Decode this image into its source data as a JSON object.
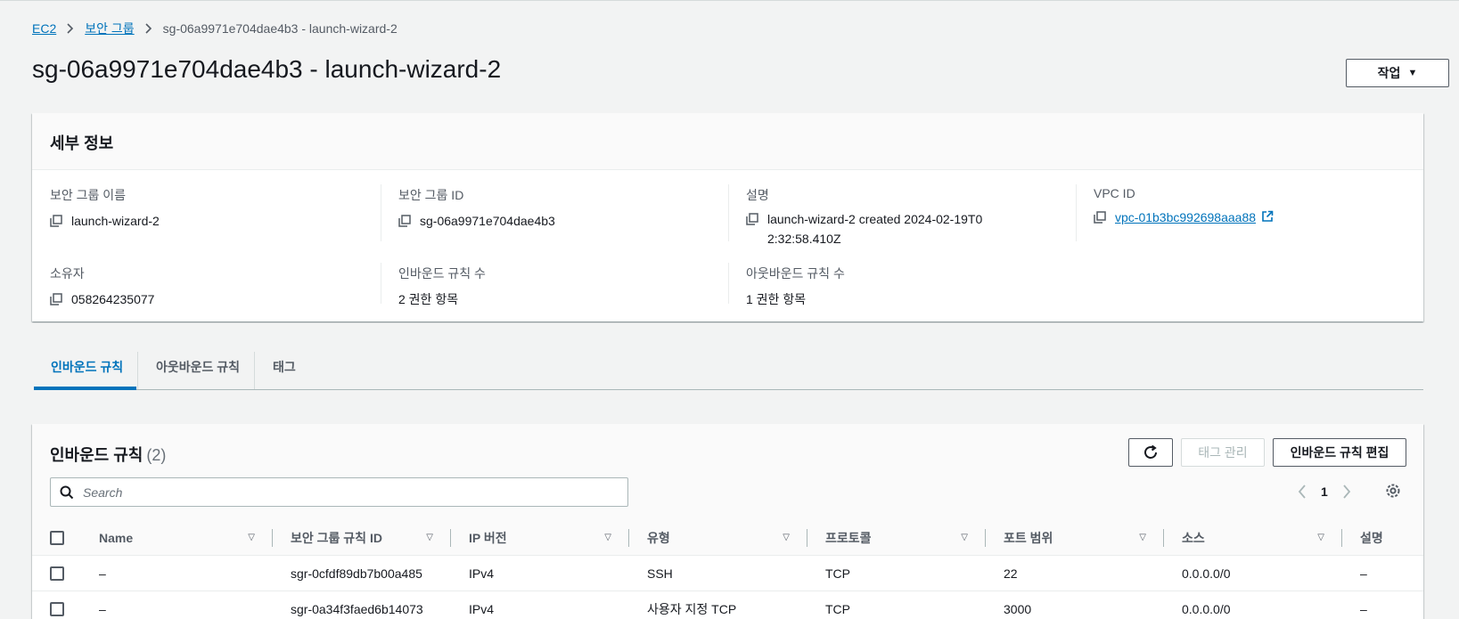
{
  "breadcrumb": {
    "items": [
      "EC2",
      "보안 그룹"
    ],
    "current": "sg-06a9971e704dae4b3 - launch-wizard-2"
  },
  "page": {
    "title": "sg-06a9971e704dae4b3 - launch-wizard-2",
    "actions_label": "작업"
  },
  "details": {
    "heading": "세부 정보",
    "fields": {
      "sg_name": {
        "label": "보안 그룹 이름",
        "value": "launch-wizard-2"
      },
      "sg_id": {
        "label": "보안 그룹 ID",
        "value": "sg-06a9971e704dae4b3"
      },
      "description": {
        "label": "설명",
        "value": "launch-wizard-2 created 2024-02-19T02:32:58.410Z"
      },
      "vpc_id": {
        "label": "VPC ID",
        "value": "vpc-01b3bc992698aaa88"
      },
      "owner": {
        "label": "소유자",
        "value": "058264235077"
      },
      "inbound_count": {
        "label": "인바운드 규칙 수",
        "value": "2 권한 항목"
      },
      "outbound_count": {
        "label": "아웃바운드 규칙 수",
        "value": "1 권한 항목"
      }
    }
  },
  "tabs": [
    "인바운드 규칙",
    "아웃바운드 규칙",
    "태그"
  ],
  "inbound": {
    "title": "인바운드 규칙",
    "count": "(2)",
    "manage_tags_label": "태그 관리",
    "edit_label": "인바운드 규칙 편집",
    "search_placeholder": "Search",
    "page": "1",
    "columns": [
      "Name",
      "보안 그룹 규칙 ID",
      "IP 버전",
      "유형",
      "프로토콜",
      "포트 범위",
      "소스",
      "설명"
    ],
    "rows": [
      [
        "–",
        "sgr-0cfdf89db7b00a485",
        "IPv4",
        "SSH",
        "TCP",
        "22",
        "0.0.0.0/0",
        "–"
      ],
      [
        "–",
        "sgr-0a34f3faed6b14073",
        "IPv4",
        "사용자 지정 TCP",
        "TCP",
        "3000",
        "0.0.0.0/0",
        "–"
      ]
    ]
  },
  "colors": {
    "link": "#0073bb",
    "text": "#16191f",
    "secondary": "#545b64",
    "background": "#f2f3f3"
  }
}
